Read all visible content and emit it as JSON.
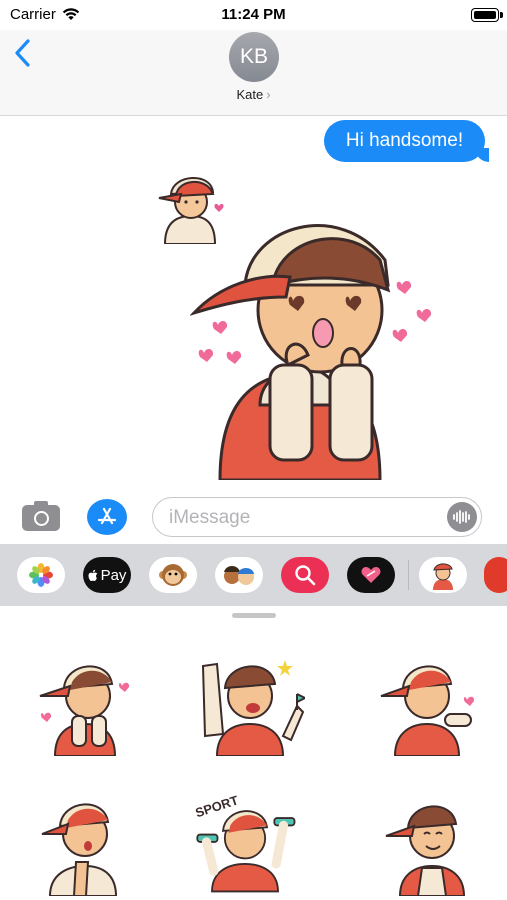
{
  "status_bar": {
    "carrier": "Carrier",
    "time": "11:24 PM"
  },
  "header": {
    "avatar_initials": "KB",
    "contact_name": "Kate",
    "contact_chevron": "›"
  },
  "messages": [
    {
      "text": "Hi handsome!",
      "direction": "outgoing",
      "color": "#1b8cf7"
    }
  ],
  "composer": {
    "placeholder": "iMessage",
    "value": ""
  },
  "app_drawer": {
    "apple_pay_label": "Pay",
    "apps": [
      "photos-icon",
      "apple-pay-icon",
      "animoji-monkey-icon",
      "memoji-icon",
      "web-images-search-icon",
      "digital-touch-heart-icon",
      "sticker-app-icon",
      "red-app-icon"
    ]
  },
  "sticker_panel": {
    "stickers": [
      "boy-hearts",
      "boy-cheering-flag",
      "boy-blowing-kiss",
      "boy-surprised",
      "boy-sport-dumbbells",
      "boy-smiling"
    ],
    "sticker_text": "SPORT"
  },
  "colors": {
    "accent": "#1b8cf7",
    "header_bg": "#f7f7f7",
    "drawer_bg": "#d7d8dc"
  }
}
